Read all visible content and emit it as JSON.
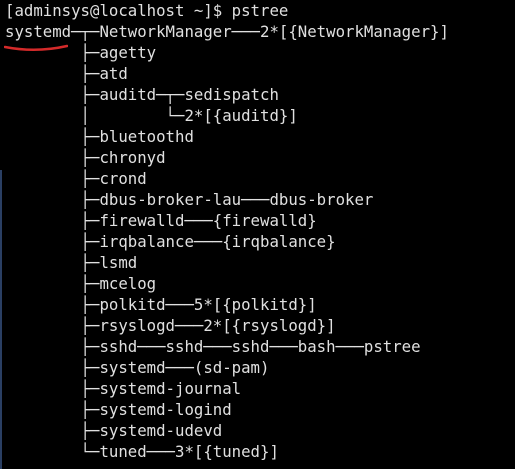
{
  "terminal": {
    "prompt_line": "[adminsys@localhost ~]$ pstree",
    "tree_lines": [
      "systemd─┬─NetworkManager───2*[{NetworkManager}]",
      "        ├─agetty",
      "        ├─atd",
      "        ├─auditd─┬─sedispatch",
      "        │        └─2*[{auditd}]",
      "        ├─bluetoothd",
      "        ├─chronyd",
      "        ├─crond",
      "        ├─dbus-broker-lau───dbus-broker",
      "        ├─firewalld───{firewalld}",
      "        ├─irqbalance───{irqbalance}",
      "        ├─lsmd",
      "        ├─mcelog",
      "        ├─polkitd───5*[{polkitd}]",
      "        ├─rsyslogd───2*[{rsyslogd}]",
      "        ├─sshd───sshd───sshd───bash───pstree",
      "        ├─systemd───(sd-pam)",
      "        ├─systemd-journal",
      "        ├─systemd-logind",
      "        ├─systemd-udevd",
      "        └─tuned───3*[{tuned}]"
    ],
    "annotation_color": "#d42a2a"
  }
}
